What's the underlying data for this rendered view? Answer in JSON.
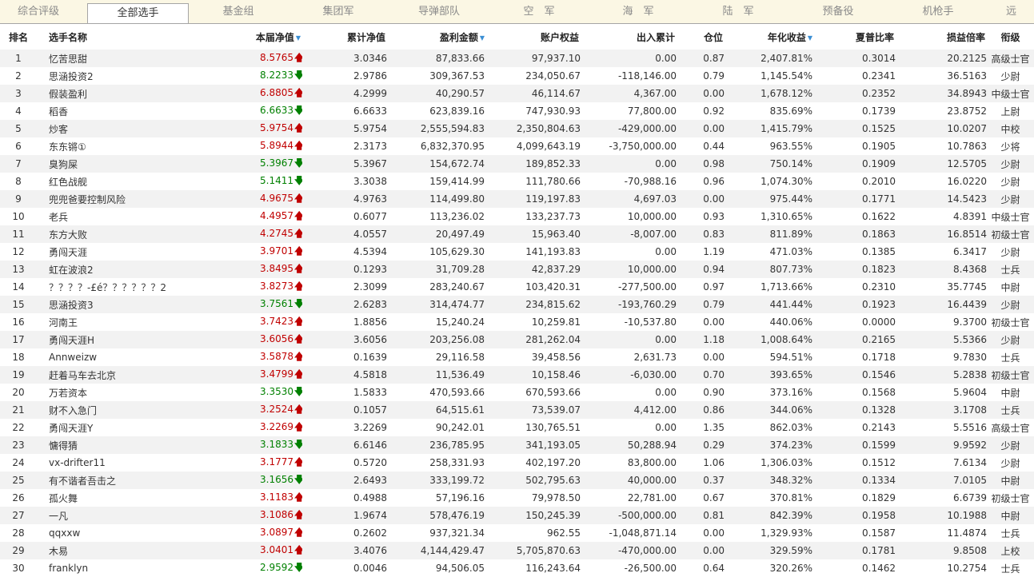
{
  "tabs": [
    "综合评级",
    "全部选手",
    "基金组",
    "集团军",
    "导弹部队",
    "空　军",
    "海　军",
    "陆　军",
    "预备役",
    "机枪手",
    "远"
  ],
  "active_tab": 1,
  "headers": {
    "rank": "排名",
    "name": "选手名称",
    "nav": "本届净值",
    "cum": "累计净值",
    "profit": "盈利金额",
    "equity": "账户权益",
    "inout": "出入累计",
    "position": "仓位",
    "annual": "年化收益",
    "sharpe": "夏普比率",
    "pl_ratio": "损益倍率",
    "grade": "衔级"
  },
  "sort_indicator": "▼",
  "icons": {
    "up": "arrow-up-icon",
    "down": "arrow-down-icon"
  },
  "colors": {
    "up": "#c00000",
    "down": "#008000",
    "tab_bg": "#fbf7e4"
  },
  "rows": [
    {
      "rank": "1",
      "name": "忆苦思甜",
      "nav": "8.5765",
      "dir": "up",
      "cum": "3.0346",
      "profit": "87,833.66",
      "equity": "97,937.10",
      "inout": "0.00",
      "position": "0.87",
      "annual": "2,407.81%",
      "sharpe": "0.3014",
      "pl_ratio": "20.2125",
      "grade": "高级士官"
    },
    {
      "rank": "2",
      "name": "思涵投资2",
      "nav": "8.2233",
      "dir": "down",
      "cum": "2.9786",
      "profit": "309,367.53",
      "equity": "234,050.67",
      "inout": "-118,146.00",
      "position": "0.79",
      "annual": "1,145.54%",
      "sharpe": "0.2341",
      "pl_ratio": "36.5163",
      "grade": "少尉"
    },
    {
      "rank": "3",
      "name": "假装盈利",
      "nav": "6.8805",
      "dir": "up",
      "cum": "4.2999",
      "profit": "40,290.57",
      "equity": "46,114.67",
      "inout": "4,367.00",
      "position": "0.00",
      "annual": "1,678.12%",
      "sharpe": "0.2352",
      "pl_ratio": "34.8943",
      "grade": "中级士官"
    },
    {
      "rank": "4",
      "name": "稻香",
      "nav": "6.6633",
      "dir": "down",
      "cum": "6.6633",
      "profit": "623,839.16",
      "equity": "747,930.93",
      "inout": "77,800.00",
      "position": "0.92",
      "annual": "835.69%",
      "sharpe": "0.1739",
      "pl_ratio": "23.8752",
      "grade": "上尉"
    },
    {
      "rank": "5",
      "name": "炒客",
      "nav": "5.9754",
      "dir": "up",
      "cum": "5.9754",
      "profit": "2,555,594.83",
      "equity": "2,350,804.63",
      "inout": "-429,000.00",
      "position": "0.00",
      "annual": "1,415.79%",
      "sharpe": "0.1525",
      "pl_ratio": "10.0207",
      "grade": "中校"
    },
    {
      "rank": "6",
      "name": "东东锵①",
      "nav": "5.8944",
      "dir": "up",
      "cum": "2.3173",
      "profit": "6,832,370.95",
      "equity": "4,099,643.19",
      "inout": "-3,750,000.00",
      "position": "0.44",
      "annual": "963.55%",
      "sharpe": "0.1905",
      "pl_ratio": "10.7863",
      "grade": "少将"
    },
    {
      "rank": "7",
      "name": "臭狗屎",
      "nav": "5.3967",
      "dir": "down",
      "cum": "5.3967",
      "profit": "154,672.74",
      "equity": "189,852.33",
      "inout": "0.00",
      "position": "0.98",
      "annual": "750.14%",
      "sharpe": "0.1909",
      "pl_ratio": "12.5705",
      "grade": "少尉"
    },
    {
      "rank": "8",
      "name": "红色战舰",
      "nav": "5.1411",
      "dir": "down",
      "cum": "3.3038",
      "profit": "159,414.99",
      "equity": "111,780.66",
      "inout": "-70,988.16",
      "position": "0.96",
      "annual": "1,074.30%",
      "sharpe": "0.2010",
      "pl_ratio": "16.0220",
      "grade": "少尉"
    },
    {
      "rank": "9",
      "name": "兜兜爸要控制风险",
      "nav": "4.9675",
      "dir": "up",
      "cum": "4.9763",
      "profit": "114,499.80",
      "equity": "119,197.83",
      "inout": "4,697.03",
      "position": "0.00",
      "annual": "975.44%",
      "sharpe": "0.1771",
      "pl_ratio": "14.5423",
      "grade": "少尉"
    },
    {
      "rank": "10",
      "name": "老兵",
      "nav": "4.4957",
      "dir": "up",
      "cum": "0.6077",
      "profit": "113,236.02",
      "equity": "133,237.73",
      "inout": "10,000.00",
      "position": "0.93",
      "annual": "1,310.65%",
      "sharpe": "0.1622",
      "pl_ratio": "4.8391",
      "grade": "中级士官"
    },
    {
      "rank": "11",
      "name": "东方大败",
      "nav": "4.2745",
      "dir": "up",
      "cum": "4.0557",
      "profit": "20,497.49",
      "equity": "15,963.40",
      "inout": "-8,007.00",
      "position": "0.83",
      "annual": "811.89%",
      "sharpe": "0.1863",
      "pl_ratio": "16.8514",
      "grade": "初级士官"
    },
    {
      "rank": "12",
      "name": "勇闯天涯",
      "nav": "3.9701",
      "dir": "up",
      "cum": "4.5394",
      "profit": "105,629.30",
      "equity": "141,193.83",
      "inout": "0.00",
      "position": "1.19",
      "annual": "471.03%",
      "sharpe": "0.1385",
      "pl_ratio": "6.3417",
      "grade": "少尉"
    },
    {
      "rank": "13",
      "name": "虹在波浪2",
      "nav": "3.8495",
      "dir": "up",
      "cum": "0.1293",
      "profit": "31,709.28",
      "equity": "42,837.29",
      "inout": "10,000.00",
      "position": "0.94",
      "annual": "807.73%",
      "sharpe": "0.1823",
      "pl_ratio": "8.4368",
      "grade": "士兵"
    },
    {
      "rank": "14",
      "name": "？？？？-£é？？？？？？2",
      "nav": "3.8273",
      "dir": "up",
      "cum": "2.3099",
      "profit": "283,240.67",
      "equity": "103,420.31",
      "inout": "-277,500.00",
      "position": "0.97",
      "annual": "1,713.66%",
      "sharpe": "0.2310",
      "pl_ratio": "35.7745",
      "grade": "中尉"
    },
    {
      "rank": "15",
      "name": "思涵投资3",
      "nav": "3.7561",
      "dir": "down",
      "cum": "2.6283",
      "profit": "314,474.77",
      "equity": "234,815.62",
      "inout": "-193,760.29",
      "position": "0.79",
      "annual": "441.44%",
      "sharpe": "0.1923",
      "pl_ratio": "16.4439",
      "grade": "少尉"
    },
    {
      "rank": "16",
      "name": "河南王",
      "nav": "3.7423",
      "dir": "up",
      "cum": "1.8856",
      "profit": "15,240.24",
      "equity": "10,259.81",
      "inout": "-10,537.80",
      "position": "0.00",
      "annual": "440.06%",
      "sharpe": "0.0000",
      "pl_ratio": "9.3700",
      "grade": "初级士官"
    },
    {
      "rank": "17",
      "name": "勇闯天涯H",
      "nav": "3.6056",
      "dir": "up",
      "cum": "3.6056",
      "profit": "203,256.08",
      "equity": "281,262.04",
      "inout": "0.00",
      "position": "1.18",
      "annual": "1,008.64%",
      "sharpe": "0.2165",
      "pl_ratio": "5.5366",
      "grade": "少尉"
    },
    {
      "rank": "18",
      "name": "Annweizw",
      "nav": "3.5878",
      "dir": "up",
      "cum": "0.1639",
      "profit": "29,116.58",
      "equity": "39,458.56",
      "inout": "2,631.73",
      "position": "0.00",
      "annual": "594.51%",
      "sharpe": "0.1718",
      "pl_ratio": "9.7830",
      "grade": "士兵"
    },
    {
      "rank": "19",
      "name": "赶着马车去北京",
      "nav": "3.4799",
      "dir": "up",
      "cum": "4.5818",
      "profit": "11,536.49",
      "equity": "10,158.46",
      "inout": "-6,030.00",
      "position": "0.70",
      "annual": "393.65%",
      "sharpe": "0.1546",
      "pl_ratio": "5.2838",
      "grade": "初级士官"
    },
    {
      "rank": "20",
      "name": "万若资本",
      "nav": "3.3530",
      "dir": "down",
      "cum": "1.5833",
      "profit": "470,593.66",
      "equity": "670,593.66",
      "inout": "0.00",
      "position": "0.90",
      "annual": "373.16%",
      "sharpe": "0.1568",
      "pl_ratio": "5.9604",
      "grade": "中尉"
    },
    {
      "rank": "21",
      "name": "财不入急门",
      "nav": "3.2524",
      "dir": "up",
      "cum": "0.1057",
      "profit": "64,515.61",
      "equity": "73,539.07",
      "inout": "4,412.00",
      "position": "0.86",
      "annual": "344.06%",
      "sharpe": "0.1328",
      "pl_ratio": "3.1708",
      "grade": "士兵"
    },
    {
      "rank": "22",
      "name": "勇闯天涯Y",
      "nav": "3.2269",
      "dir": "up",
      "cum": "3.2269",
      "profit": "90,242.01",
      "equity": "130,765.51",
      "inout": "0.00",
      "position": "1.35",
      "annual": "862.03%",
      "sharpe": "0.2143",
      "pl_ratio": "5.5516",
      "grade": "高级士官"
    },
    {
      "rank": "23",
      "name": "慵得猜",
      "nav": "3.1833",
      "dir": "down",
      "cum": "6.6146",
      "profit": "236,785.95",
      "equity": "341,193.05",
      "inout": "50,288.94",
      "position": "0.29",
      "annual": "374.23%",
      "sharpe": "0.1599",
      "pl_ratio": "9.9592",
      "grade": "少尉"
    },
    {
      "rank": "24",
      "name": "vx-drifter11",
      "nav": "3.1777",
      "dir": "up",
      "cum": "0.5720",
      "profit": "258,331.93",
      "equity": "402,197.20",
      "inout": "83,800.00",
      "position": "1.06",
      "annual": "1,306.03%",
      "sharpe": "0.1512",
      "pl_ratio": "7.6134",
      "grade": "少尉"
    },
    {
      "rank": "25",
      "name": "有不谐者吾击之",
      "nav": "3.1656",
      "dir": "down",
      "cum": "2.6493",
      "profit": "333,199.72",
      "equity": "502,795.63",
      "inout": "40,000.00",
      "position": "0.37",
      "annual": "348.32%",
      "sharpe": "0.1334",
      "pl_ratio": "7.0105",
      "grade": "中尉"
    },
    {
      "rank": "26",
      "name": "孤火舞",
      "nav": "3.1183",
      "dir": "up",
      "cum": "0.4988",
      "profit": "57,196.16",
      "equity": "79,978.50",
      "inout": "22,781.00",
      "position": "0.67",
      "annual": "370.81%",
      "sharpe": "0.1829",
      "pl_ratio": "6.6739",
      "grade": "初级士官"
    },
    {
      "rank": "27",
      "name": "一凡",
      "nav": "3.1086",
      "dir": "up",
      "cum": "1.9674",
      "profit": "578,476.19",
      "equity": "150,245.39",
      "inout": "-500,000.00",
      "position": "0.81",
      "annual": "842.39%",
      "sharpe": "0.1958",
      "pl_ratio": "10.1988",
      "grade": "中尉"
    },
    {
      "rank": "28",
      "name": "qqxxw",
      "nav": "3.0897",
      "dir": "up",
      "cum": "0.2602",
      "profit": "937,321.34",
      "equity": "962.55",
      "inout": "-1,048,871.14",
      "position": "0.00",
      "annual": "1,329.93%",
      "sharpe": "0.1587",
      "pl_ratio": "11.4874",
      "grade": "士兵"
    },
    {
      "rank": "29",
      "name": "木易",
      "nav": "3.0401",
      "dir": "up",
      "cum": "3.4076",
      "profit": "4,144,429.47",
      "equity": "5,705,870.63",
      "inout": "-470,000.00",
      "position": "0.00",
      "annual": "329.59%",
      "sharpe": "0.1781",
      "pl_ratio": "9.8508",
      "grade": "上校"
    },
    {
      "rank": "30",
      "name": "franklyn",
      "nav": "2.9592",
      "dir": "down",
      "cum": "0.0046",
      "profit": "94,506.05",
      "equity": "116,243.64",
      "inout": "-26,500.00",
      "position": "0.64",
      "annual": "320.26%",
      "sharpe": "0.1462",
      "pl_ratio": "10.2754",
      "grade": "士兵"
    }
  ]
}
